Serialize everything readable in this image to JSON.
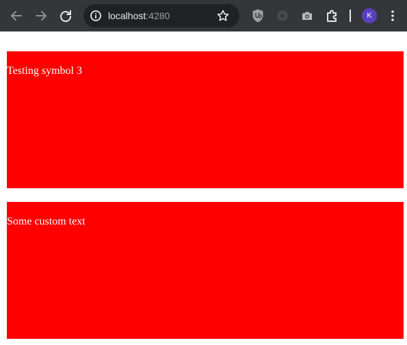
{
  "browser": {
    "address": {
      "host": "localhost",
      "port": ":4280"
    },
    "profile_initial": "K",
    "colors": {
      "toolbar": "#35363a",
      "omnibox": "#202124",
      "avatar": "#5a3fc0"
    },
    "icons": [
      "back-arrow-icon",
      "forward-arrow-icon",
      "reload-icon",
      "site-info-icon",
      "bookmark-star-icon",
      "ublock-extension-icon",
      "disabled-extension-icon",
      "camera-extension-icon",
      "extensions-puzzle-icon",
      "kebab-menu-icon"
    ]
  },
  "page": {
    "background": "#ffffff",
    "box_color": "#ff0000",
    "boxes": [
      {
        "text": "Testing symbol 3"
      },
      {
        "text": "Some custom text"
      }
    ]
  }
}
